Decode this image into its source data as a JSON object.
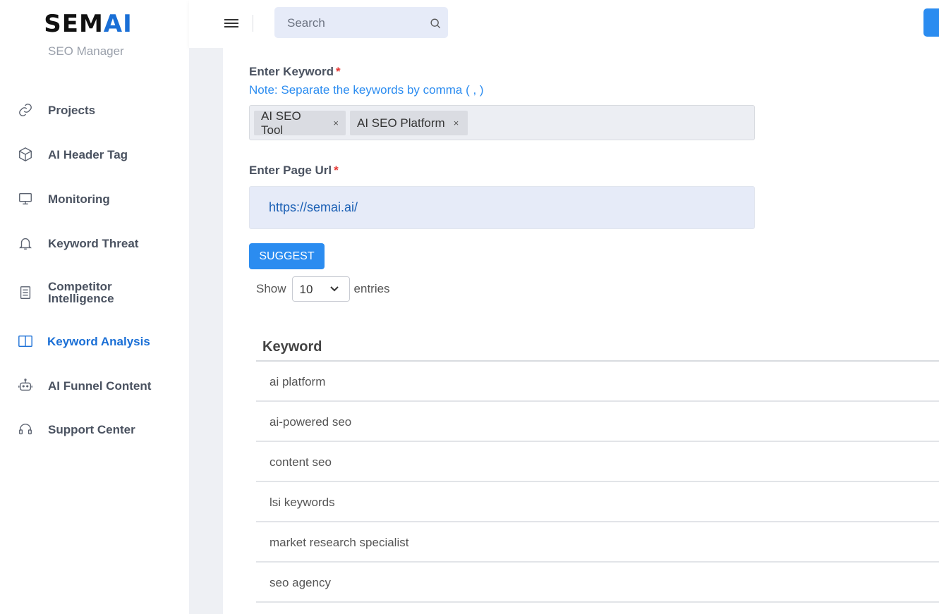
{
  "brand": {
    "logo_main": "SEM",
    "logo_accent": "AI",
    "subtitle": "SEO Manager"
  },
  "sidebar": {
    "items": [
      {
        "label": "Projects",
        "icon": "link-icon",
        "active": false
      },
      {
        "label": "AI Header Tag",
        "icon": "cube-icon",
        "active": false
      },
      {
        "label": "Monitoring",
        "icon": "monitor-icon",
        "active": false
      },
      {
        "label": "Keyword Threat",
        "icon": "bell-icon",
        "active": false
      },
      {
        "label": "Competitor Intelligence",
        "icon": "document-icon",
        "active": false
      },
      {
        "label": "Keyword Analysis",
        "icon": "columns-icon",
        "active": true
      },
      {
        "label": "AI Funnel Content",
        "icon": "robot-icon",
        "active": false
      },
      {
        "label": "Support Center",
        "icon": "headset-icon",
        "active": false
      }
    ]
  },
  "header": {
    "search_placeholder": "Search"
  },
  "form": {
    "keyword_label": "Enter Keyword",
    "required_mark": "*",
    "keyword_note": "Note: Separate the keywords by comma ( , )",
    "tags": [
      "AI SEO Tool",
      "AI SEO Platform"
    ],
    "tag_remove": "×",
    "url_label": "Enter Page Url",
    "url_value": "https://semai.ai/",
    "suggest_label": "SUGGEST"
  },
  "entries": {
    "show": "Show",
    "value": "10",
    "suffix": "entries"
  },
  "table": {
    "header": "Keyword",
    "rows": [
      "ai platform",
      "ai-powered seo",
      "content seo",
      "lsi keywords",
      "market research specialist",
      "seo agency"
    ]
  },
  "colors": {
    "accent": "#2b8cf0",
    "active_nav": "#1a6fd6",
    "required": "#e53935"
  }
}
